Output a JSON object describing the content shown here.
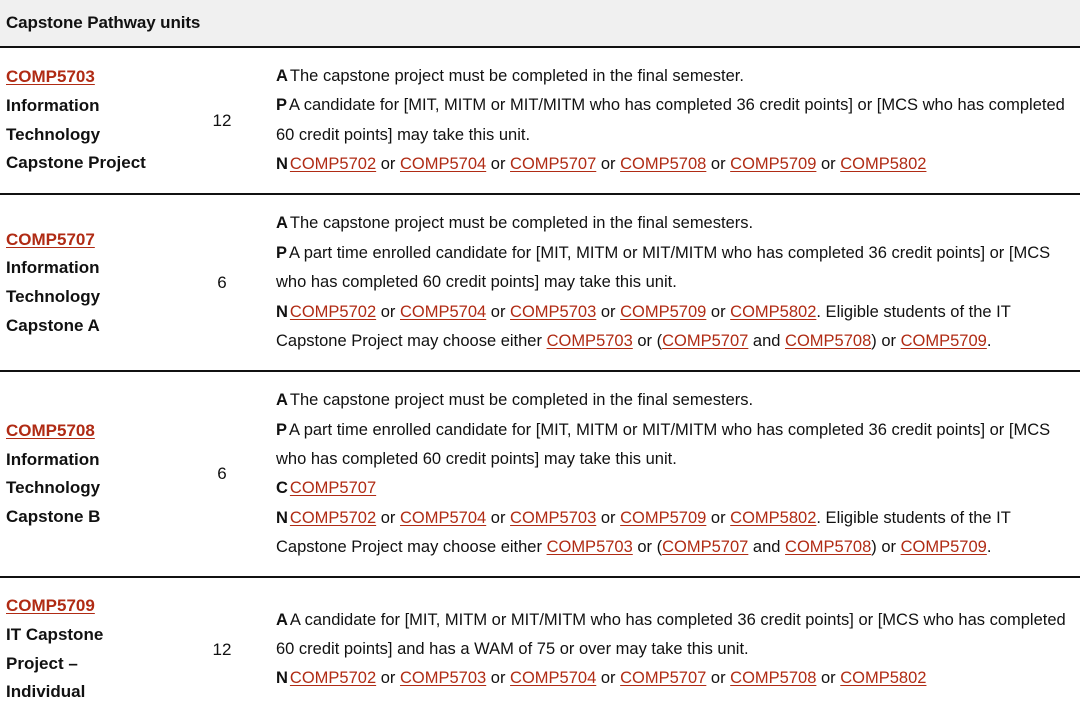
{
  "table": {
    "caption": "Capstone Pathway units",
    "colors": {
      "link": "#b02b14",
      "caption_background": "#f0f0f0",
      "rule": "#111111",
      "text": "#111111"
    },
    "rows": [
      {
        "code": "COMP5703",
        "name": "Information Technology Capstone Project",
        "credit_points": "12",
        "lines": [
          {
            "tag": "A",
            "segments": [
              {
                "type": "text",
                "text": "The capstone project must be completed in the final semester."
              }
            ]
          },
          {
            "tag": "P",
            "segments": [
              {
                "type": "text",
                "text": "A candidate for [MIT, MITM or MIT/MITM who has completed 36 credit points] or [MCS who has completed 60 credit points] may take this unit."
              }
            ]
          },
          {
            "tag": "N",
            "segments": [
              {
                "type": "link",
                "text": "COMP5702"
              },
              {
                "type": "text",
                "text": " or "
              },
              {
                "type": "link",
                "text": "COMP5704"
              },
              {
                "type": "text",
                "text": " or "
              },
              {
                "type": "link",
                "text": "COMP5707"
              },
              {
                "type": "text",
                "text": " or "
              },
              {
                "type": "link",
                "text": "COMP5708"
              },
              {
                "type": "text",
                "text": " or "
              },
              {
                "type": "link",
                "text": "COMP5709"
              },
              {
                "type": "text",
                "text": " or "
              },
              {
                "type": "link",
                "text": "COMP5802"
              }
            ]
          }
        ]
      },
      {
        "code": "COMP5707",
        "name": "Information Technology Capstone A",
        "credit_points": "6",
        "lines": [
          {
            "tag": "A",
            "segments": [
              {
                "type": "text",
                "text": "The capstone project must be completed in the final semesters."
              }
            ]
          },
          {
            "tag": "P",
            "segments": [
              {
                "type": "text",
                "text": "A part time enrolled candidate for [MIT, MITM or MIT/MITM who has completed 36 credit points] or [MCS who has completed 60 credit points] may take this unit."
              }
            ]
          },
          {
            "tag": "N",
            "segments": [
              {
                "type": "link",
                "text": "COMP5702"
              },
              {
                "type": "text",
                "text": " or "
              },
              {
                "type": "link",
                "text": "COMP5704"
              },
              {
                "type": "text",
                "text": " or "
              },
              {
                "type": "link",
                "text": "COMP5703"
              },
              {
                "type": "text",
                "text": " or "
              },
              {
                "type": "link",
                "text": "COMP5709"
              },
              {
                "type": "text",
                "text": " or "
              },
              {
                "type": "link",
                "text": "COMP5802"
              },
              {
                "type": "text",
                "text": ". Eligible students of the IT Capstone Project may choose either "
              },
              {
                "type": "link",
                "text": "COMP5703"
              },
              {
                "type": "text",
                "text": " or ("
              },
              {
                "type": "link",
                "text": "COMP5707"
              },
              {
                "type": "text",
                "text": " and "
              },
              {
                "type": "link",
                "text": "COMP5708"
              },
              {
                "type": "text",
                "text": ") or "
              },
              {
                "type": "link",
                "text": "COMP5709"
              },
              {
                "type": "text",
                "text": "."
              }
            ]
          }
        ]
      },
      {
        "code": "COMP5708",
        "name": "Information Technology Capstone B",
        "credit_points": "6",
        "lines": [
          {
            "tag": "A",
            "segments": [
              {
                "type": "text",
                "text": "The capstone project must be completed in the final semesters."
              }
            ]
          },
          {
            "tag": "P",
            "segments": [
              {
                "type": "text",
                "text": "A part time enrolled candidate for [MIT, MITM or MIT/MITM who has completed 36 credit points] or [MCS who has completed 60 credit points] may take this unit."
              }
            ]
          },
          {
            "tag": "C",
            "segments": [
              {
                "type": "link",
                "text": "COMP5707"
              }
            ]
          },
          {
            "tag": "N",
            "segments": [
              {
                "type": "link",
                "text": "COMP5702"
              },
              {
                "type": "text",
                "text": " or "
              },
              {
                "type": "link",
                "text": "COMP5704"
              },
              {
                "type": "text",
                "text": " or "
              },
              {
                "type": "link",
                "text": "COMP5703"
              },
              {
                "type": "text",
                "text": " or "
              },
              {
                "type": "link",
                "text": "COMP5709"
              },
              {
                "type": "text",
                "text": " or "
              },
              {
                "type": "link",
                "text": "COMP5802"
              },
              {
                "type": "text",
                "text": ". Eligible students of the IT Capstone Project may choose either "
              },
              {
                "type": "link",
                "text": "COMP5703"
              },
              {
                "type": "text",
                "text": " or ("
              },
              {
                "type": "link",
                "text": "COMP5707"
              },
              {
                "type": "text",
                "text": " and "
              },
              {
                "type": "link",
                "text": "COMP5708"
              },
              {
                "type": "text",
                "text": ") or "
              },
              {
                "type": "link",
                "text": "COMP5709"
              },
              {
                "type": "text",
                "text": "."
              }
            ]
          }
        ]
      },
      {
        "code": "COMP5709",
        "name": "IT Capstone Project – Individual",
        "credit_points": "12",
        "lines": [
          {
            "tag": "A",
            "segments": [
              {
                "type": "text",
                "text": "A candidate for [MIT, MITM or MIT/MITM who has completed 36 credit points] or [MCS who has completed 60 credit points] and has a WAM of 75 or over may take this unit."
              }
            ]
          },
          {
            "tag": "N",
            "segments": [
              {
                "type": "link",
                "text": "COMP5702"
              },
              {
                "type": "text",
                "text": " or "
              },
              {
                "type": "link",
                "text": "COMP5703"
              },
              {
                "type": "text",
                "text": " or "
              },
              {
                "type": "link",
                "text": "COMP5704"
              },
              {
                "type": "text",
                "text": " or "
              },
              {
                "type": "link",
                "text": "COMP5707"
              },
              {
                "type": "text",
                "text": " or "
              },
              {
                "type": "link",
                "text": "COMP5708"
              },
              {
                "type": "text",
                "text": " or "
              },
              {
                "type": "link",
                "text": "COMP5802"
              }
            ]
          }
        ]
      }
    ]
  }
}
